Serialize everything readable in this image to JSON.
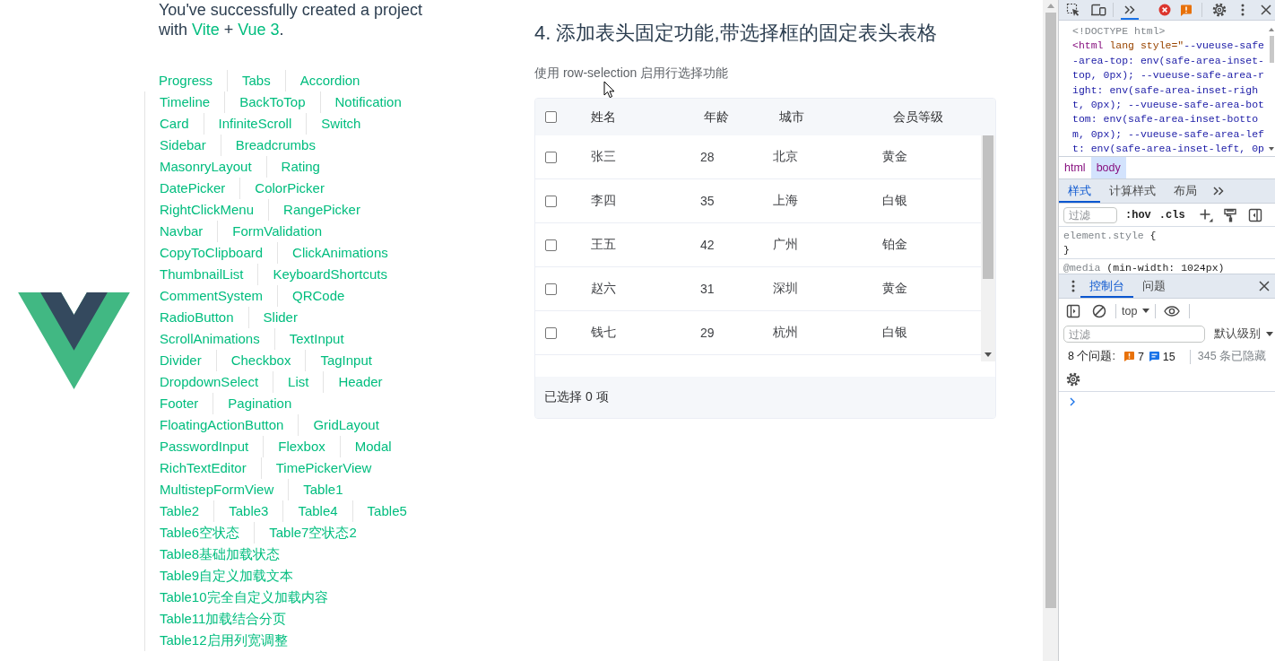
{
  "greeting": {
    "parts": [
      {
        "kind": "text",
        "text": "You've successfully created a project with "
      },
      {
        "kind": "link",
        "text": "Vite"
      },
      {
        "kind": "text",
        "text": " + "
      },
      {
        "kind": "link",
        "text": "Vue 3"
      },
      {
        "kind": "text",
        "text": "."
      }
    ]
  },
  "nav_links": [
    "Progress",
    "Tabs",
    "Accordion",
    "Timeline",
    "BackToTop",
    "Notification",
    "Card",
    "InfiniteScroll",
    "Switch",
    "Sidebar",
    "Breadcrumbs",
    "MasonryLayout",
    "Rating",
    "DatePicker",
    "ColorPicker",
    "RightClickMenu",
    "RangePicker",
    "Navbar",
    "FormValidation",
    "CopyToClipboard",
    "ClickAnimations",
    "ThumbnailList",
    "KeyboardShortcuts",
    "CommentSystem",
    "QRCode",
    "RadioButton",
    "Slider",
    "ScrollAnimations",
    "TextInput",
    "Divider",
    "Checkbox",
    "TagInput",
    "DropdownSelect",
    "List",
    "Header",
    "Footer",
    "Pagination",
    "FloatingActionButton",
    "GridLayout",
    "PasswordInput",
    "Flexbox",
    "Modal",
    "RichTextEditor",
    "TimePickerView",
    "MultistepFormView",
    "Table1",
    "Table2",
    "Table3",
    "Table4",
    "Table5",
    "Table6空状态",
    "Table7空状态2",
    "Table8基础加载状态",
    "Table9自定义加载文本",
    "Table10完全自定义加载内容",
    "Table11加载结合分页",
    "Table12启用列宽调整"
  ],
  "section": {
    "title": "4. 添加表头固定功能,带选择框的固定表头表格",
    "description": "使用 row-selection 启用行选择功能"
  },
  "table": {
    "select_all_checked": false,
    "columns": [
      "姓名",
      "年龄",
      "城市",
      "会员等级"
    ],
    "rows": [
      {
        "selected": false,
        "cells": [
          "张三",
          "28",
          "北京",
          "黄金"
        ]
      },
      {
        "selected": false,
        "cells": [
          "李四",
          "35",
          "上海",
          "白银"
        ]
      },
      {
        "selected": false,
        "cells": [
          "王五",
          "42",
          "广州",
          "铂金"
        ]
      },
      {
        "selected": false,
        "cells": [
          "赵六",
          "31",
          "深圳",
          "黄金"
        ]
      },
      {
        "selected": false,
        "cells": [
          "钱七",
          "29",
          "杭州",
          "白银"
        ]
      }
    ],
    "footer": "已选择 0 项"
  },
  "devtools": {
    "main_tab_overflow": {
      "selected": true
    },
    "dom_lines": [
      [
        {
          "kind": "doctype",
          "text": "<!DOCTYPE html>"
        }
      ],
      [
        {
          "kind": "tag",
          "text": "<html"
        },
        {
          "kind": "attr",
          "text": " lang style=\""
        },
        {
          "kind": "value",
          "text": "--vueuse-safe"
        }
      ],
      [
        {
          "kind": "value",
          "text": "-area-top: env(safe-area-inset-"
        }
      ],
      [
        {
          "kind": "value",
          "text": "top, 0px); --vueuse-safe-area-r"
        }
      ],
      [
        {
          "kind": "value",
          "text": "ight: env(safe-area-inset-righ"
        }
      ],
      [
        {
          "kind": "value",
          "text": "t, 0px); --vueuse-safe-area-bot"
        }
      ],
      [
        {
          "kind": "value",
          "text": "tom: env(safe-area-inset-botto"
        }
      ],
      [
        {
          "kind": "value",
          "text": "m, 0px); --vueuse-safe-area-lef"
        }
      ],
      [
        {
          "kind": "value",
          "text": "t: env(safe-area-inset-left, 0p"
        }
      ]
    ],
    "breadcrumbs": [
      {
        "label": "html",
        "selected": false
      },
      {
        "label": "body",
        "selected": true
      }
    ],
    "style_tabs": [
      {
        "label": "样式",
        "selected": true
      },
      {
        "label": "计算样式",
        "selected": false
      },
      {
        "label": "布局",
        "selected": false
      }
    ],
    "styles_filter": {
      "placeholder": "过滤"
    },
    "style_toggles": [
      ":hov",
      ".cls"
    ],
    "style_blocks": [
      [
        [
          {
            "kind": "muted",
            "text": "element.style"
          },
          {
            "kind": "plain",
            "text": " {"
          }
        ],
        [
          {
            "kind": "plain",
            "text": "}"
          }
        ]
      ],
      [
        [
          {
            "kind": "muted",
            "text": "@media"
          },
          {
            "kind": "plain",
            "text": " (min-width: 1024px)"
          }
        ]
      ]
    ],
    "drawer_tabs": [
      {
        "label": "控制台",
        "selected": true
      },
      {
        "label": "问题",
        "selected": false
      }
    ],
    "console_context": "top",
    "console_filter": {
      "placeholder": "过滤"
    },
    "log_level": "默认级别",
    "issues": {
      "label": "8 个问题:",
      "counts": [
        {
          "kind": "warning",
          "count": "7"
        },
        {
          "kind": "info",
          "count": "15"
        }
      ],
      "hidden": "345 条已隐藏"
    }
  }
}
